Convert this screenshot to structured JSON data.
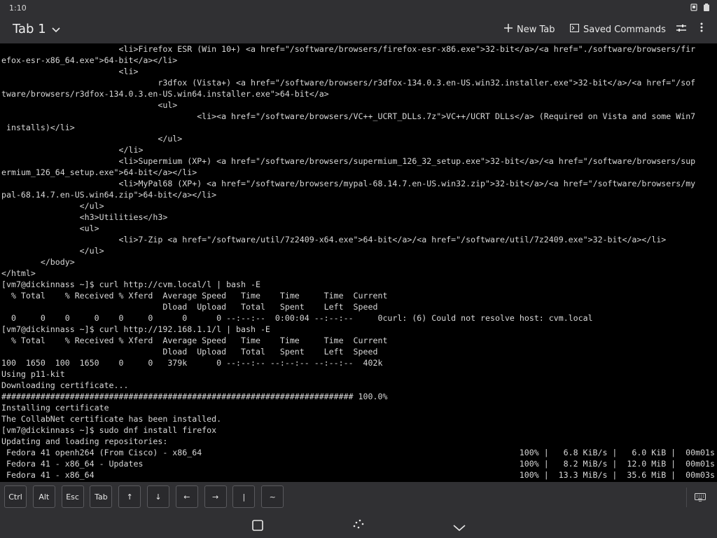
{
  "status_bar": {
    "time": "1:10"
  },
  "toolbar": {
    "tab_title": "Tab 1",
    "new_tab_label": "New Tab",
    "saved_commands_label": "Saved Commands"
  },
  "terminal": {
    "lines": [
      "                        <li>Firefox ESR (Win 10+) <a href=\"/software/browsers/firefox-esr-x86.exe\">32-bit</a>/<a href=\"./software/browsers/fir",
      "efox-esr-x86_64.exe\">64-bit</a></li>",
      "                        <li>",
      "                                r3dfox (Vista+) <a href=\"/software/browsers/r3dfox-134.0.3.en-US.win32.installer.exe\">32-bit</a>/<a href=\"/sof",
      "tware/browsers/r3dfox-134.0.3.en-US.win64.installer.exe\">64-bit</a>",
      "                                <ul>",
      "                                        <li><a href=\"/software/browsers/VC++_UCRT_DLLs.7z\">VC++/UCRT DLLs</a> (Required on Vista and some Win7",
      " installs)</li>",
      "                                </ul>",
      "                        </li>",
      "                        <li>Supermium (XP+) <a href=\"/software/browsers/supermium_126_32_setup.exe\">32-bit</a>/<a href=\"/software/browsers/sup",
      "ermium_126_64_setup.exe\">64-bit</a></li>",
      "                        <li>MyPal68 (XP+) <a href=\"/software/browsers/mypal-68.14.7.en-US.win32.zip\">32-bit</a>/<a href=\"/software/browsers/my",
      "pal-68.14.7.en-US.win64.zip\">64-bit</a></li>",
      "                </ul>",
      "                <h3>Utilities</h3>",
      "                <ul>",
      "                        <li>7-Zip <a href=\"/software/util/7z2409-x64.exe\">64-bit</a>/<a href=\"/software/util/7z2409.exe\">32-bit</a></li>",
      "                </ul>",
      "        </body>",
      "</html>",
      "[vm7@dickinnass ~]$ curl http://cvm.local/l | bash -E",
      "  % Total    % Received % Xferd  Average Speed   Time    Time     Time  Current",
      "                                 Dload  Upload   Total   Spent    Left  Speed",
      "  0     0    0     0    0     0      0      0 --:--:--  0:00:04 --:--:--     0curl: (6) Could not resolve host: cvm.local",
      "[vm7@dickinnass ~]$ curl http://192.168.1.1/l | bash -E",
      "  % Total    % Received % Xferd  Average Speed   Time    Time     Time  Current",
      "                                 Dload  Upload   Total   Spent    Left  Speed",
      "100  1650  100  1650    0     0   379k      0 --:--:-- --:--:-- --:--:--  402k",
      "Using p11-kit",
      "Downloading certificate...",
      "######################################################################## 100.0%",
      "Installing certificate",
      "The CollabNet certificate has been installed.",
      "[vm7@dickinnass ~]$ sudo dnf install firefox",
      "Updating and loading repositories:"
    ],
    "repo_rows": [
      {
        "name": " Fedora 41 openh264 (From Cisco) - x86_64",
        "stats": "100% |   6.8 KiB/s |   6.0 KiB |  00m01s"
      },
      {
        "name": " Fedora 41 - x86_64 - Updates",
        "stats": "100% |   8.2 MiB/s |  12.0 MiB |  00m01s"
      },
      {
        "name": " Fedora 41 - x86_64",
        "stats": "100% |  13.3 MiB/s |  35.6 MiB |  00m03s"
      }
    ]
  },
  "extra_keys": [
    {
      "label": "Ctrl",
      "name": "key-ctrl"
    },
    {
      "label": "Alt",
      "name": "key-alt"
    },
    {
      "label": "Esc",
      "name": "key-esc"
    },
    {
      "label": "Tab",
      "name": "key-tab"
    },
    {
      "label": "↑",
      "name": "key-arrow-up"
    },
    {
      "label": "↓",
      "name": "key-arrow-down"
    },
    {
      "label": "←",
      "name": "key-arrow-left"
    },
    {
      "label": "→",
      "name": "key-arrow-right"
    },
    {
      "label": "|",
      "name": "key-pipe"
    },
    {
      "label": "~",
      "name": "key-tilde"
    }
  ],
  "icons": {
    "screenshot": "screenshot-icon",
    "battery": "battery-icon",
    "tab_chevron": "chevron-down-icon",
    "new_tab": "plus-icon",
    "saved_commands": "terminal-icon",
    "settings": "sliders-icon",
    "menu": "more-vertical-icon",
    "keyboard": "keyboard-icon",
    "recents": "square-icon",
    "home": "home-dots-icon",
    "back": "chevron-down-icon"
  }
}
